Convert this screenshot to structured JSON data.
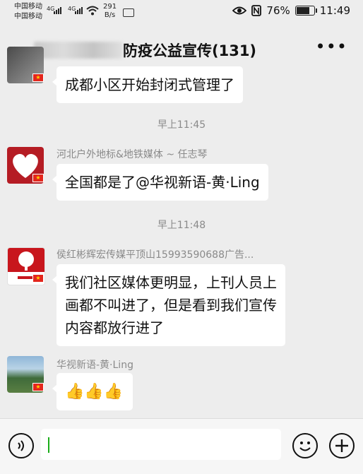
{
  "status_bar": {
    "carrier_1": "中国移动",
    "carrier_2": "中国移动",
    "net_1": "4G",
    "net_2": "4G",
    "speed_value": "291",
    "speed_unit": "B/s",
    "battery": "76%",
    "time": "11:49"
  },
  "header": {
    "back_icon": "chevron-left-icon",
    "title": "防疫公益宣传(131)",
    "more_icon": "more-dots-icon"
  },
  "messages": {
    "m0": {
      "text": "成都小区开始封闭式管理了"
    },
    "t1": "早上11:45",
    "m1": {
      "sender": "河北户外地标&地铁媒体 ~ 任志琴",
      "text": "全国都是了@华视新语-黄·Ling"
    },
    "t2": "早上11:48",
    "m2": {
      "sender": "侯红彬辉宏传媒平顶山15993590688广告...",
      "line1": "我们社区媒体更明显，上刊人员上",
      "line2": "画都不叫进了，但是看到我们宣传",
      "line3": "内容都放行进了"
    },
    "m3": {
      "sender": "华视新语-黄·Ling",
      "thumbs": "👍👍👍"
    }
  },
  "input_bar": {
    "voice_icon": "voice-icon",
    "emoji_icon": "emoji-icon",
    "plus_icon": "plus-icon"
  },
  "colors": {
    "bg": "#ededed",
    "bubble": "#ffffff",
    "caret": "#1aad19"
  }
}
